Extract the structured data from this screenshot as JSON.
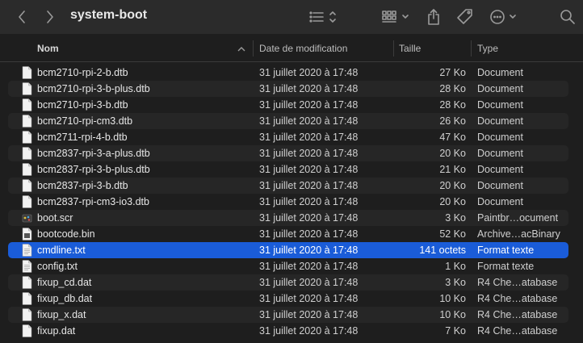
{
  "window": {
    "title": "system-boot"
  },
  "icons": {
    "back": "chevron-left-icon",
    "forward": "chevron-right-icon",
    "view": "list-view-icon",
    "group": "icon-grid-icon",
    "share": "share-icon",
    "tag": "tag-icon",
    "more": "ellipsis-icon",
    "search": "search-icon"
  },
  "colors": {
    "selection": "#1a5cd8",
    "background": "#1e1e1e"
  },
  "columns": {
    "name": "Nom",
    "date": "Date de modification",
    "size": "Taille",
    "kind": "Type"
  },
  "files": [
    {
      "name": "bcm2710-rpi-2-b.dtb",
      "date": "31 juillet 2020 à 17:48",
      "size": "27 Ko",
      "kind": "Document",
      "icon": "document-icon"
    },
    {
      "name": "bcm2710-rpi-3-b-plus.dtb",
      "date": "31 juillet 2020 à 17:48",
      "size": "28 Ko",
      "kind": "Document",
      "icon": "document-icon"
    },
    {
      "name": "bcm2710-rpi-3-b.dtb",
      "date": "31 juillet 2020 à 17:48",
      "size": "28 Ko",
      "kind": "Document",
      "icon": "document-icon"
    },
    {
      "name": "bcm2710-rpi-cm3.dtb",
      "date": "31 juillet 2020 à 17:48",
      "size": "26 Ko",
      "kind": "Document",
      "icon": "document-icon"
    },
    {
      "name": "bcm2711-rpi-4-b.dtb",
      "date": "31 juillet 2020 à 17:48",
      "size": "47 Ko",
      "kind": "Document",
      "icon": "document-icon"
    },
    {
      "name": "bcm2837-rpi-3-a-plus.dtb",
      "date": "31 juillet 2020 à 17:48",
      "size": "20 Ko",
      "kind": "Document",
      "icon": "document-icon"
    },
    {
      "name": "bcm2837-rpi-3-b-plus.dtb",
      "date": "31 juillet 2020 à 17:48",
      "size": "21 Ko",
      "kind": "Document",
      "icon": "document-icon"
    },
    {
      "name": "bcm2837-rpi-3-b.dtb",
      "date": "31 juillet 2020 à 17:48",
      "size": "20 Ko",
      "kind": "Document",
      "icon": "document-icon"
    },
    {
      "name": "bcm2837-rpi-cm3-io3.dtb",
      "date": "31 juillet 2020 à 17:48",
      "size": "20 Ko",
      "kind": "Document",
      "icon": "document-icon"
    },
    {
      "name": "boot.scr",
      "date": "31 juillet 2020 à 17:48",
      "size": "3 Ko",
      "kind": "Paintbr…ocument",
      "icon": "paint-document-icon"
    },
    {
      "name": "bootcode.bin",
      "date": "31 juillet 2020 à 17:48",
      "size": "52 Ko",
      "kind": "Archive…acBinary",
      "icon": "binary-icon"
    },
    {
      "name": "cmdline.txt",
      "date": "31 juillet 2020 à 17:48",
      "size": "141 octets",
      "kind": "Format texte",
      "icon": "text-document-icon",
      "selected": true
    },
    {
      "name": "config.txt",
      "date": "31 juillet 2020 à 17:48",
      "size": "1 Ko",
      "kind": "Format texte",
      "icon": "text-document-icon"
    },
    {
      "name": "fixup_cd.dat",
      "date": "31 juillet 2020 à 17:48",
      "size": "3 Ko",
      "kind": "R4 Che…atabase",
      "icon": "document-icon"
    },
    {
      "name": "fixup_db.dat",
      "date": "31 juillet 2020 à 17:48",
      "size": "10 Ko",
      "kind": "R4 Che…atabase",
      "icon": "document-icon"
    },
    {
      "name": "fixup_x.dat",
      "date": "31 juillet 2020 à 17:48",
      "size": "10 Ko",
      "kind": "R4 Che…atabase",
      "icon": "document-icon"
    },
    {
      "name": "fixup.dat",
      "date": "31 juillet 2020 à 17:48",
      "size": "7 Ko",
      "kind": "R4 Che…atabase",
      "icon": "document-icon"
    }
  ]
}
